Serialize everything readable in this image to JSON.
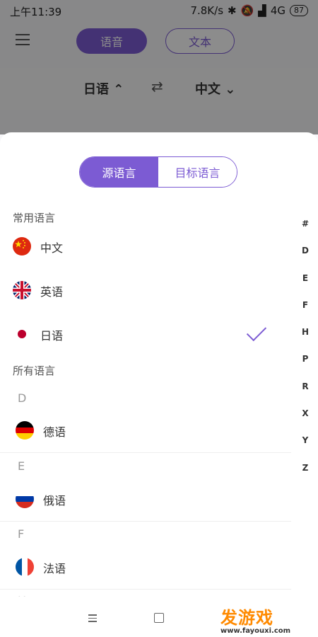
{
  "status": {
    "time": "上午11:39",
    "speed": "7.8K/s",
    "network": "4G",
    "battery": "87"
  },
  "topbar": {
    "mode_voice": "语音",
    "mode_text": "文本"
  },
  "langbar": {
    "source": "日语 ⌃",
    "swap": "⇄",
    "target": "中文 ⌄"
  },
  "sheet": {
    "segment": {
      "source": "源语言",
      "target": "目标语言"
    },
    "common_title": "常用语言",
    "common": [
      {
        "label": "中文",
        "icon": "china-flag-icon"
      },
      {
        "label": "英语",
        "icon": "uk-flag-icon"
      },
      {
        "label": "日语",
        "icon": "japan-flag-icon",
        "selected": true
      }
    ],
    "all_title": "所有语言",
    "groups": [
      {
        "letter": "D",
        "label": "德语",
        "icon": "germany-flag-icon"
      },
      {
        "letter": "E",
        "label": "俄语",
        "icon": "russia-flag-icon"
      },
      {
        "letter": "F",
        "label": "法语",
        "icon": "france-flag-icon"
      }
    ],
    "next_letter_peek": "H",
    "index": [
      "#",
      "D",
      "E",
      "F",
      "H",
      "P",
      "R",
      "X",
      "Y",
      "Z"
    ]
  },
  "navbar": {
    "watermark_main": "发游戏",
    "watermark_url": "www.fayouxi.com"
  },
  "colors": {
    "accent": "#7c5bd3"
  }
}
